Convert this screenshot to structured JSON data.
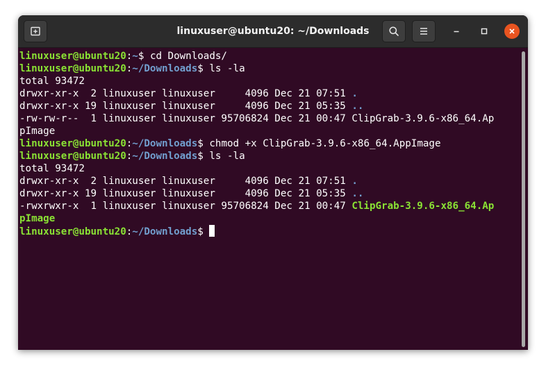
{
  "window": {
    "title": "linuxuser@ubuntu20: ~/Downloads"
  },
  "titlebar": {
    "new_tab_icon": "new-tab-icon",
    "search_icon": "search-icon",
    "menu_icon": "hamburger-menu-icon",
    "minimize_icon": "minimize-icon",
    "maximize_icon": "maximize-icon",
    "close_icon": "close-icon"
  },
  "colors": {
    "background": "#300a24",
    "user_host": "#8ae234",
    "path": "#729fcf",
    "executable": "#8ae234",
    "close_button": "#e95420"
  },
  "terminal": {
    "lines": [
      {
        "type": "prompt",
        "user": "linuxuser@ubuntu20",
        "sep": ":",
        "path": "~",
        "sym": "$ ",
        "cmd": "cd Downloads/"
      },
      {
        "type": "prompt",
        "user": "linuxuser@ubuntu20",
        "sep": ":",
        "path": "~/Downloads",
        "sym": "$ ",
        "cmd": "ls -la"
      },
      {
        "type": "text",
        "text": "total 93472"
      },
      {
        "type": "entry",
        "text": "drwxr-xr-x  2 linuxuser linuxuser     4096 Dec 21 07:51 ",
        "name": ".",
        "style": "dir"
      },
      {
        "type": "entry",
        "text": "drwxr-xr-x 19 linuxuser linuxuser     4096 Dec 21 05:35 ",
        "name": "..",
        "style": "dir"
      },
      {
        "type": "entry",
        "text": "-rw-rw-r--  1 linuxuser linuxuser 95706824 Dec 21 00:47 ",
        "name": "ClipGrab-3.9.6-x86_64.Ap",
        "style": "plain"
      },
      {
        "type": "entry",
        "text": "",
        "name": "pImage",
        "style": "plain"
      },
      {
        "type": "prompt",
        "user": "linuxuser@ubuntu20",
        "sep": ":",
        "path": "~/Downloads",
        "sym": "$ ",
        "cmd": "chmod +x ClipGrab-3.9.6-x86_64.AppImage"
      },
      {
        "type": "prompt",
        "user": "linuxuser@ubuntu20",
        "sep": ":",
        "path": "~/Downloads",
        "sym": "$ ",
        "cmd": "ls -la"
      },
      {
        "type": "text",
        "text": "total 93472"
      },
      {
        "type": "entry",
        "text": "drwxr-xr-x  2 linuxuser linuxuser     4096 Dec 21 07:51 ",
        "name": ".",
        "style": "dir"
      },
      {
        "type": "entry",
        "text": "drwxr-xr-x 19 linuxuser linuxuser     4096 Dec 21 05:35 ",
        "name": "..",
        "style": "dir"
      },
      {
        "type": "entry",
        "text": "-rwxrwxr-x  1 linuxuser linuxuser 95706824 Dec 21 00:47 ",
        "name": "ClipGrab-3.9.6-x86_64.Ap",
        "style": "exec"
      },
      {
        "type": "entry",
        "text": "",
        "name": "pImage",
        "style": "exec"
      },
      {
        "type": "prompt",
        "user": "linuxuser@ubuntu20",
        "sep": ":",
        "path": "~/Downloads",
        "sym": "$ ",
        "cmd": "",
        "cursor": true
      }
    ]
  }
}
